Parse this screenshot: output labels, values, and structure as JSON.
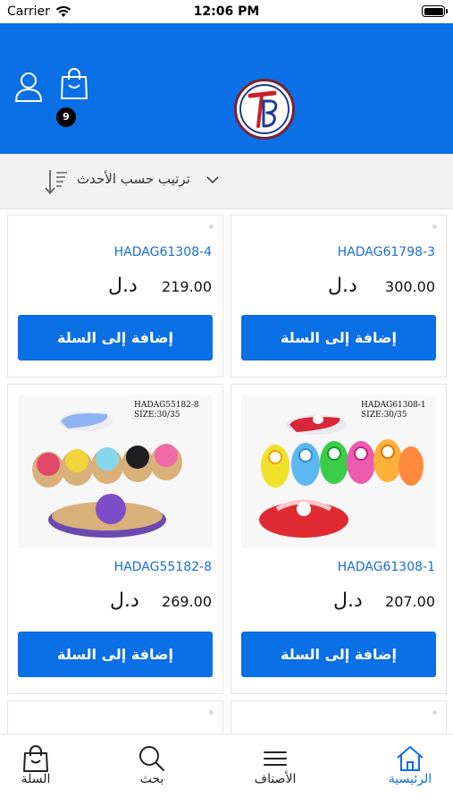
{
  "status_bar": {
    "carrier": "Carrier",
    "time": "12:06 PM"
  },
  "header": {
    "cart_count": "9"
  },
  "sort": {
    "label": "ترتيب حسب الأحدث"
  },
  "products": [
    {
      "name": "HADAG61798-3",
      "price": "300.00",
      "currency": "د.ل",
      "button": "إضافة إلى السلة",
      "image_label": ""
    },
    {
      "name": "HADAG61308-4",
      "price": "219.00",
      "currency": "د.ل",
      "button": "إضافة إلى السلة",
      "image_label": ""
    },
    {
      "name": "HADAG61308-1",
      "price": "207.00",
      "currency": "د.ل",
      "button": "إضافة إلى السلة",
      "image_label": "HADAG61308-1",
      "image_size": "SIZE:30/35"
    },
    {
      "name": "HADAG55182-8",
      "price": "269.00",
      "currency": "د.ل",
      "button": "إضافة إلى السلة",
      "image_label": "HADAG55182-8",
      "image_size": "SIZE:30/35"
    }
  ],
  "tabs": [
    {
      "label": "الرئيسية",
      "icon": "home-icon",
      "active": true
    },
    {
      "label": "الأصناف",
      "icon": "menu-icon",
      "active": false
    },
    {
      "label": "بحث",
      "icon": "search-icon",
      "active": false
    },
    {
      "label": "السلة",
      "icon": "bag-icon",
      "active": false
    }
  ],
  "colors": {
    "primary": "#0b6fe6",
    "link": "#1a6fd1"
  }
}
